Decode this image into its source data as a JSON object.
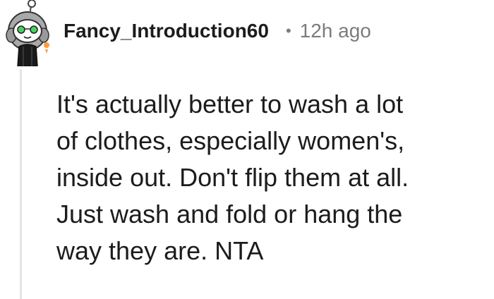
{
  "comment": {
    "author": "Fancy_Introduction60",
    "separator": "•",
    "timestamp": "12h ago",
    "body_lines": [
      "It's actually better to wash a lot",
      "of clothes, especially women's,",
      "inside out. Don't flip them at all.",
      "Just wash and fold or hang the",
      "way they are. NTA"
    ]
  },
  "icons": {
    "avatar": "snoo-avatar-icon"
  },
  "colors": {
    "text_primary": "#1c1c1c",
    "text_meta": "#7c7c7c",
    "thread_line": "#e4e4e4",
    "avatar_eyes": "#46d160"
  }
}
